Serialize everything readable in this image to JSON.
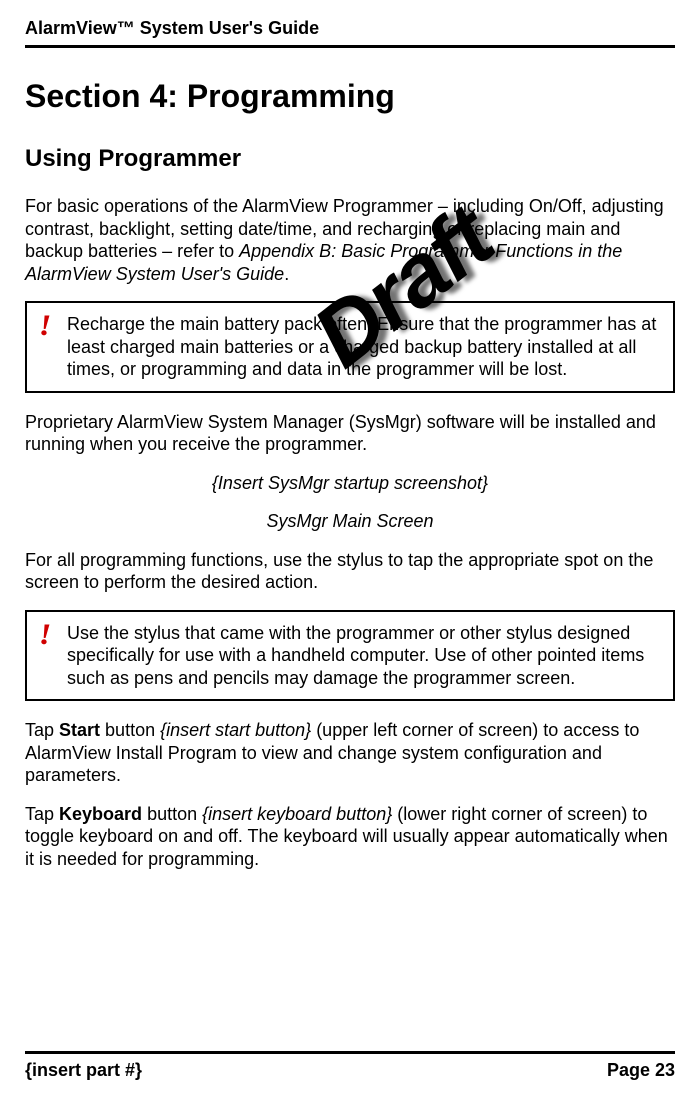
{
  "header": {
    "title": "AlarmView™ System User's Guide"
  },
  "watermark": "Draft",
  "section": {
    "title": "Section 4: Programming",
    "subheading": "Using Programmer"
  },
  "paragraphs": {
    "intro_1": "For basic operations of the AlarmView Programmer – including On/Off, adjusting contrast, backlight, setting date/time, and recharging or replacing main and backup batteries – refer to ",
    "intro_ref": "Appendix B: Basic Programmer Functions in the AlarmView System User's Guide",
    "intro_2": ".",
    "warning1": "Recharge the main battery pack often. Ensure that the programmer has at least charged main batteries or a charged backup battery installed at all times, or programming and data in the programmer will be lost.",
    "proprietary": "Proprietary AlarmView System Manager (SysMgr) software will be installed and running when you receive the programmer.",
    "screenshot_placeholder": "{Insert SysMgr startup screenshot}",
    "screenshot_caption": "SysMgr Main Screen",
    "stylus_use": "For all programming functions, use the stylus to tap the appropriate spot on the screen to perform the desired action.",
    "warning2": "Use the stylus that came with the programmer or other stylus designed specifically for use with a handheld computer. Use of other pointed items such as pens and pencils may damage the programmer screen.",
    "start_1a": "Tap ",
    "start_1b": "Start",
    "start_1c": " button ",
    "start_1d": "{insert start button}",
    "start_1e": " (upper left corner of screen) to access to AlarmView Install Program to view and change system configuration and parameters.",
    "keyboard_1a": "Tap ",
    "keyboard_1b": "Keyboard",
    "keyboard_1c": " button ",
    "keyboard_1d": "{insert keyboard button}",
    "keyboard_1e": " (lower right corner of screen) to toggle keyboard on and off. The keyboard will usually appear automatically when it is needed for programming."
  },
  "footer": {
    "left": "{insert part #}",
    "right": "Page 23"
  },
  "warning_icon": "!"
}
